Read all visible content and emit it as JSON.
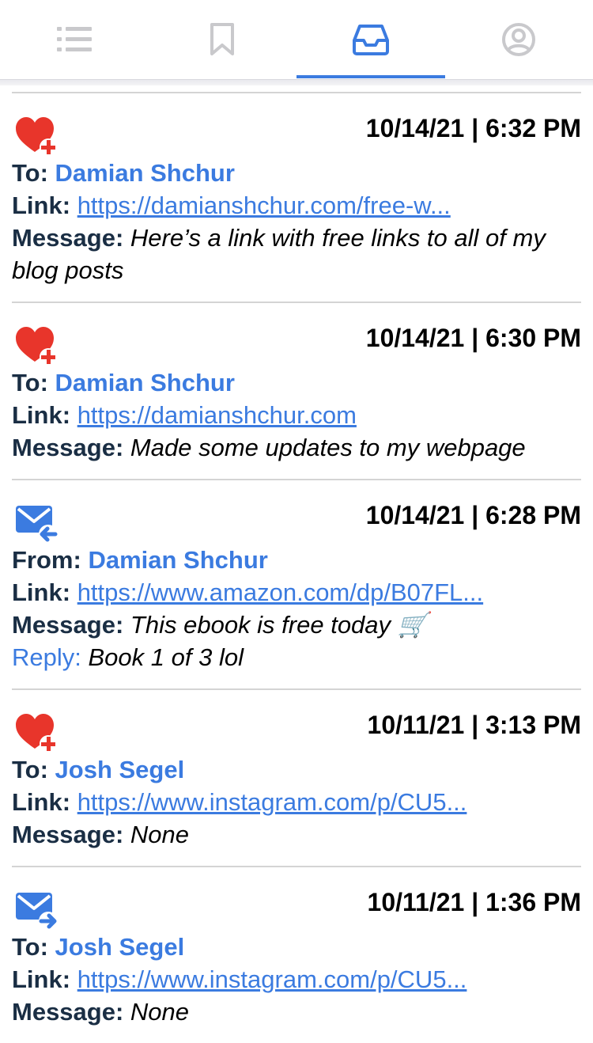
{
  "tabs": [
    {
      "name": "list",
      "icon": "list-icon",
      "active": false
    },
    {
      "name": "bookmarks",
      "icon": "bookmark-icon",
      "active": false
    },
    {
      "name": "inbox",
      "icon": "inbox-icon",
      "active": true
    },
    {
      "name": "profile",
      "icon": "user-circle-icon",
      "active": false
    }
  ],
  "colors": {
    "accent": "#3b7be0",
    "heart": "#e8352b",
    "label": "#1a2e44"
  },
  "entries": [
    {
      "icon": "heart-plus-icon",
      "timestamp": "10/14/21 | 6:32 PM",
      "party_label": "To:",
      "party_name": "Damian Shchur",
      "link_label": "Link:",
      "link": "https://damianshchur.com/free-w...",
      "message_label": "Message:",
      "message": "Here’s a link with free links to all of my blog posts"
    },
    {
      "icon": "heart-plus-icon",
      "timestamp": "10/14/21 | 6:30 PM",
      "party_label": "To:",
      "party_name": "Damian Shchur",
      "link_label": "Link:",
      "link": "https://damianshchur.com",
      "message_label": "Message:",
      "message": "Made some updates to my webpage"
    },
    {
      "icon": "mail-received-icon",
      "timestamp": "10/14/21 | 6:28 PM",
      "party_label": "From:",
      "party_name": "Damian Shchur",
      "link_label": "Link:",
      "link": "https://www.amazon.com/dp/B07FL...",
      "message_label": "Message:",
      "message": "This ebook is free today 🛒",
      "reply_label": "Reply:",
      "reply": "Book 1 of 3 lol"
    },
    {
      "icon": "heart-plus-icon",
      "timestamp": "10/11/21 | 3:13 PM",
      "party_label": "To:",
      "party_name": "Josh Segel",
      "link_label": "Link:",
      "link": "https://www.instagram.com/p/CU5...",
      "message_label": "Message:",
      "message": "None"
    },
    {
      "icon": "mail-sent-icon",
      "timestamp": "10/11/21 | 1:36 PM",
      "party_label": "To:",
      "party_name": "Josh Segel",
      "link_label": "Link:",
      "link": "https://www.instagram.com/p/CU5...",
      "message_label": "Message:",
      "message": "None"
    }
  ]
}
